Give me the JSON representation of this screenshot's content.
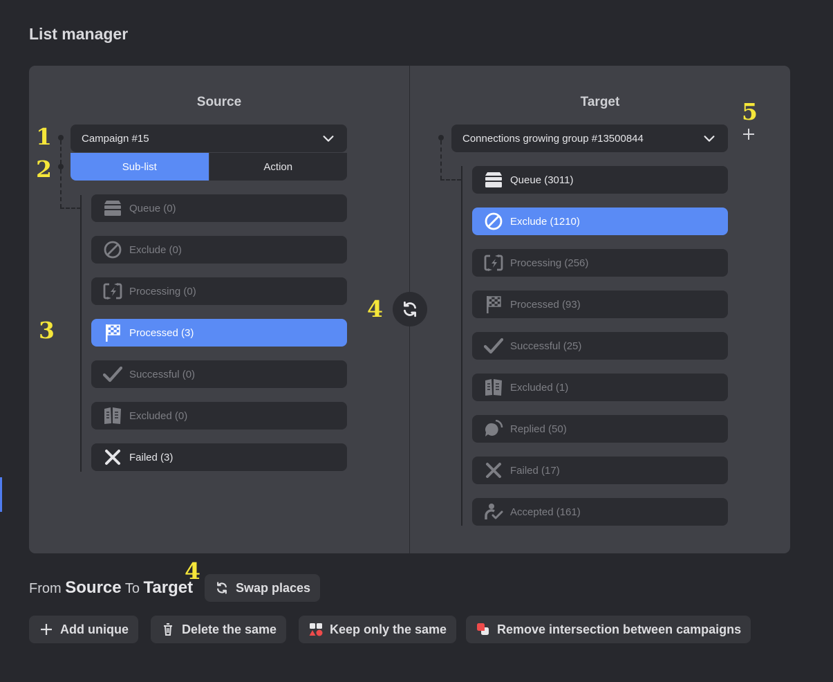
{
  "page": {
    "title": "List manager"
  },
  "source": {
    "title": "Source",
    "dropdown_value": "Campaign #15",
    "segments": [
      "Sub-list",
      "Action"
    ],
    "items": [
      {
        "label": "Queue (0)",
        "icon": "queue-icon"
      },
      {
        "label": "Exclude (0)",
        "icon": "exclude-icon"
      },
      {
        "label": "Processing (0)",
        "icon": "processing-icon"
      },
      {
        "label": "Processed (3)",
        "icon": "checkered-flag-icon"
      },
      {
        "label": "Successful (0)",
        "icon": "check-icon"
      },
      {
        "label": "Excluded (0)",
        "icon": "excluded-icon"
      },
      {
        "label": "Failed (3)",
        "icon": "x-icon"
      }
    ]
  },
  "target": {
    "title": "Target",
    "dropdown_value": "Connections growing group #13500844",
    "items": [
      {
        "label": "Queue (3011)",
        "icon": "queue-icon"
      },
      {
        "label": "Exclude (1210)",
        "icon": "exclude-icon"
      },
      {
        "label": "Processing (256)",
        "icon": "processing-icon"
      },
      {
        "label": "Processed (93)",
        "icon": "checkered-flag-icon"
      },
      {
        "label": "Successful (25)",
        "icon": "check-icon"
      },
      {
        "label": "Excluded (1)",
        "icon": "excluded-icon"
      },
      {
        "label": "Replied (50)",
        "icon": "replied-icon"
      },
      {
        "label": "Failed (17)",
        "icon": "x-icon"
      },
      {
        "label": "Accepted (161)",
        "icon": "accepted-icon"
      }
    ]
  },
  "annotations": [
    "1",
    "2",
    "3",
    "4",
    "5",
    "4"
  ],
  "footer": {
    "from": "From",
    "source": "Source",
    "to": "To",
    "target": "Target",
    "swap_label": "Swap places",
    "actions": [
      "Add unique",
      "Delete the same",
      "Keep only the same",
      "Remove intersection between campaigns"
    ]
  },
  "colors": {
    "accent": "#5a8bf5",
    "annotation": "#f5e63a",
    "panel": "#404147",
    "background": "#27282d"
  }
}
